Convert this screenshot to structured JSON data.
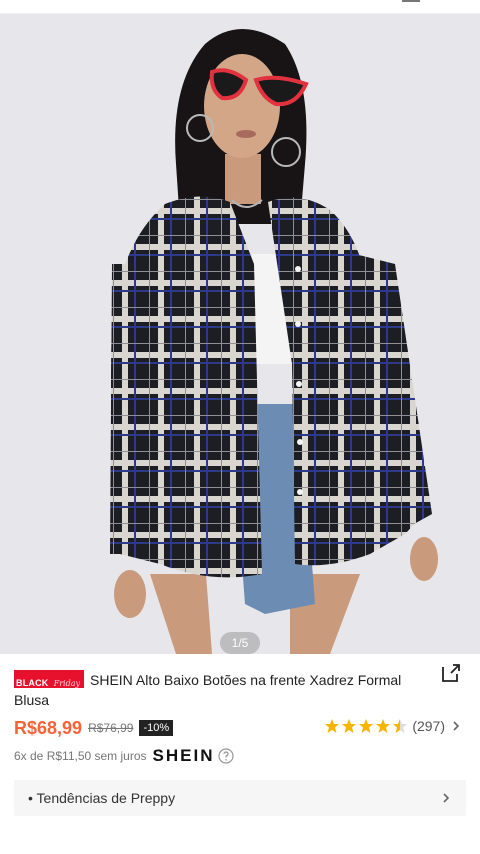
{
  "gallery": {
    "pager": "1/5",
    "image_icon": "product-photo"
  },
  "product": {
    "badge_text": "BLACK",
    "badge_script": "Friday",
    "title": "SHEIN Alto Baixo Botões na frente Xadrez Formal Blusa",
    "price": "R$68,99",
    "old_price": "R$76,99",
    "discount": "-10%",
    "rating_value": 4.5,
    "rating_count": "(297)",
    "installments": "6x de R$11,50 sem juros",
    "brand": "SHEIN"
  },
  "trends": {
    "label": "• Tendências de Preppy"
  },
  "colors": {
    "price": "#fa6338",
    "badge": "#e8112d",
    "star": "#f7b500"
  },
  "icons": {
    "share": "share-icon",
    "star": "star-icon",
    "chevron": "chevron-right-icon",
    "help": "help-icon"
  }
}
